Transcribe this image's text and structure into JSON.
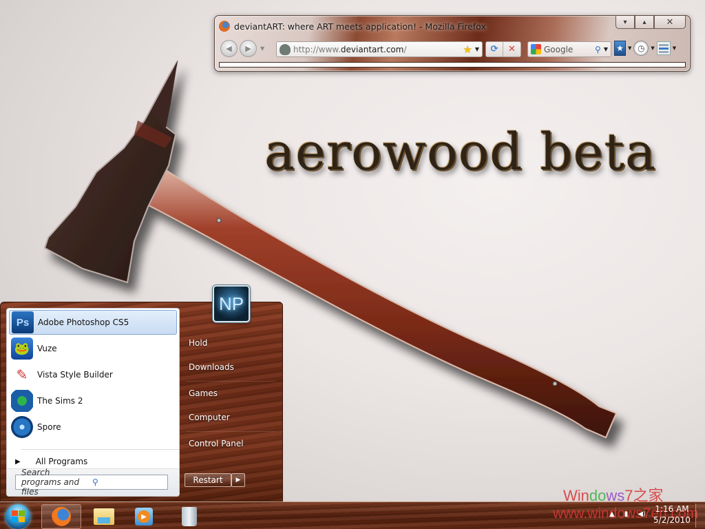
{
  "wallpaper": {
    "title": "aerowood beta",
    "subject": "fire-axe"
  },
  "firefox": {
    "window_title": "deviantART: where ART meets application! - Mozilla Firefox",
    "caption_buttons": {
      "minimize": "▾",
      "maximize": "▴",
      "close": "✕"
    },
    "nav": {
      "back": "◀",
      "forward": "▶",
      "history_dropdown": "▼"
    },
    "url": {
      "prefix": "http://www.",
      "domain": "deviantart.com",
      "suffix": "/"
    },
    "bookmark_star": "★",
    "url_dropdown": "▼",
    "reload": "⟳",
    "stop": "✕",
    "search": {
      "engine": "Google",
      "magnifier": "⚲",
      "dropdown": "▼"
    },
    "extras": {
      "bookmarks_icon": "★",
      "history_icon": "🕓",
      "dropdown": "▼"
    }
  },
  "start_menu": {
    "programs": [
      {
        "label": "Adobe Photoshop CS5",
        "icon": "photoshop-icon",
        "glyph": "Ps",
        "selected": true
      },
      {
        "label": "Vuze",
        "icon": "vuze-icon",
        "glyph": "🐸",
        "selected": false
      },
      {
        "label": "Vista Style Builder",
        "icon": "vista-style-builder-icon",
        "glyph": "✎",
        "selected": false
      },
      {
        "label": "The Sims 2",
        "icon": "sims-icon",
        "glyph": "◆",
        "selected": false
      },
      {
        "label": "Spore",
        "icon": "spore-icon",
        "glyph": "@",
        "selected": false
      }
    ],
    "all_programs": {
      "arrow": "▶",
      "label": "All Programs"
    },
    "search": {
      "placeholder": "Search programs and files",
      "icon": "⚲"
    },
    "user_picture": "NP",
    "places": [
      "Hold",
      "Downloads",
      "Games",
      "Computer",
      "Control Panel"
    ],
    "shutdown": {
      "label": "Restart",
      "arrow": "▶"
    }
  },
  "taskbar": {
    "pinned": [
      "Firefox",
      "Windows Explorer",
      "Windows Media Player",
      "Recycle Bin"
    ],
    "active": "Firefox",
    "wmp_glyph": "▶",
    "tray": {
      "flag": "▲",
      "network": "▮",
      "volume": "◀)"
    },
    "clock": {
      "time": "1:16 AM",
      "date": "5/2/2010"
    }
  },
  "watermark": {
    "brand_part1": "Win",
    "brand_part2": "do",
    "brand_part3": "ws",
    "brand_part4": "7之家",
    "url": "www.windows7en.com"
  }
}
